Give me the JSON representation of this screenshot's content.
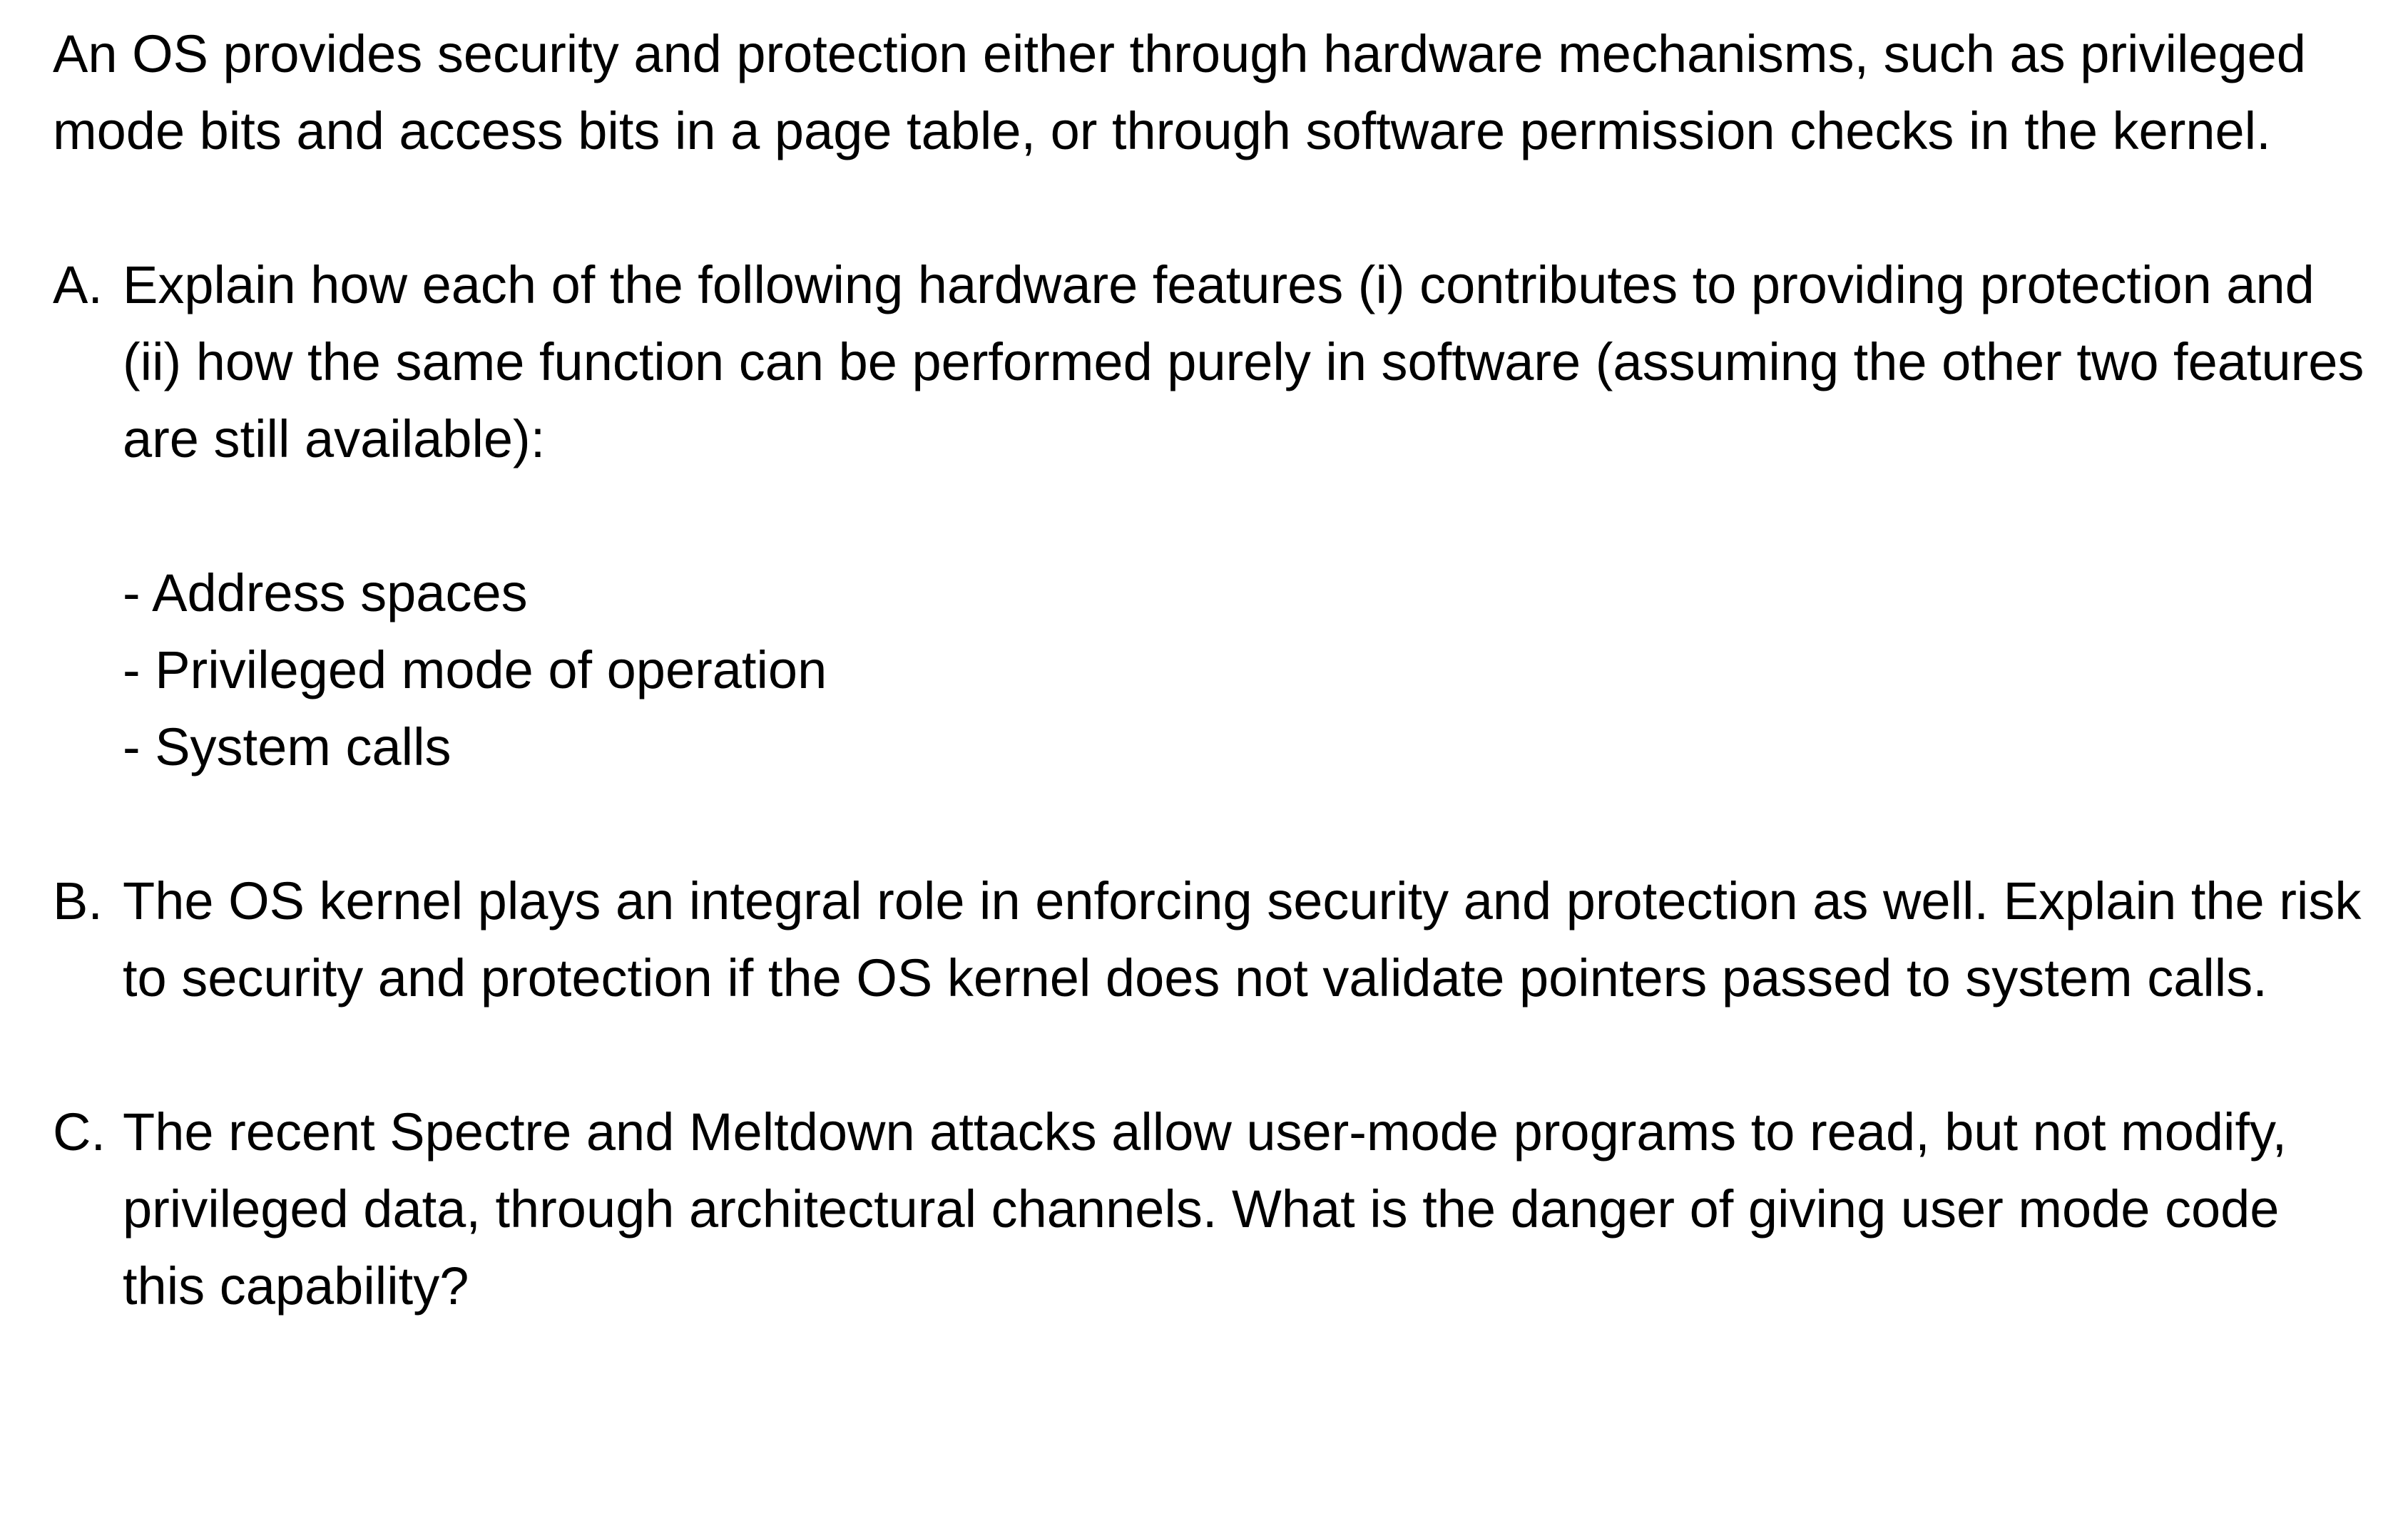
{
  "intro": "An OS provides security and protection either through hardware mechanisms, such as privileged mode bits and access bits in a page table, or through software permission checks in the kernel.",
  "questions": [
    {
      "letter": "A.",
      "text": "Explain how each of the following hardware features (i) contributes to providing protection and (ii) how the same function can be performed purely in software (assuming the other two features are still available):",
      "items": [
        "- Address spaces",
        "- Privileged mode of operation",
        "- System calls"
      ]
    },
    {
      "letter": "B.",
      "text": "The OS kernel plays an integral role in enforcing security and protection as well. Explain the risk to security and protection if the OS kernel does not validate pointers passed to system calls."
    },
    {
      "letter": "C.",
      "text": "The recent Spectre and Meltdown attacks allow user-mode programs to read, but not modify, privileged data, through architectural channels. What is the danger of giving user mode code this capability?"
    }
  ]
}
